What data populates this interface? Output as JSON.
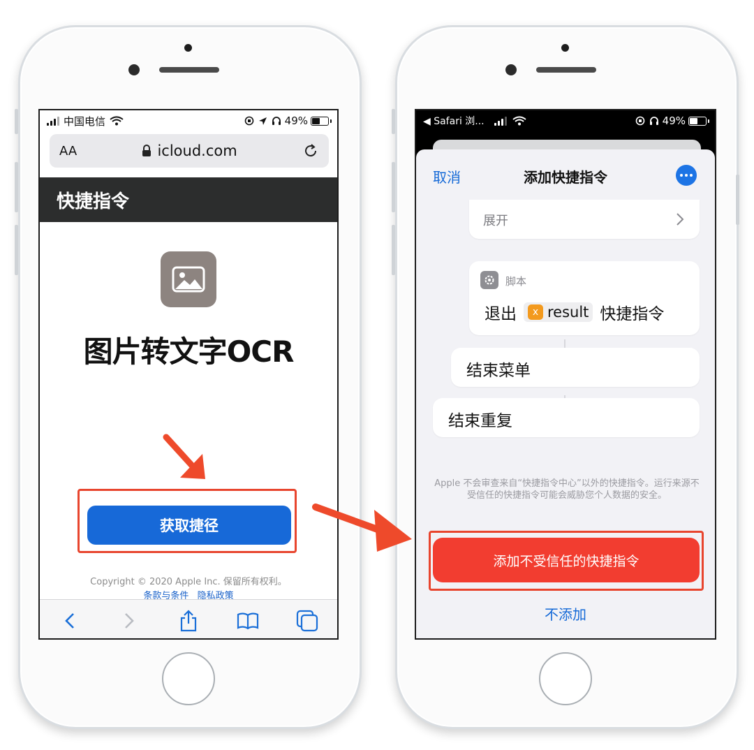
{
  "left_phone": {
    "status": {
      "carrier": "中国电信",
      "battery": "49%"
    },
    "url_bar": {
      "text_size": "AA",
      "url": "icloud.com"
    },
    "page_title": "快捷指令",
    "shortcut_name": "图片转文字OCR",
    "get_shortcut_label": "获取捷径",
    "copyright": "Copyright © 2020 Apple Inc. 保留所有权利。",
    "legal_links": [
      "条款与条件",
      "隐私政策"
    ],
    "toolbar_icons": [
      "back-icon",
      "forward-icon",
      "share-icon",
      "bookmarks-icon",
      "tabs-icon"
    ]
  },
  "right_phone": {
    "status": {
      "back_app": "◀ Safari 浏...",
      "battery": "49%"
    },
    "sheet": {
      "cancel_label": "取消",
      "title": "添加快捷指令",
      "more_icon": "more-icon"
    },
    "expand_card": {
      "label": "展开"
    },
    "script_card": {
      "category": "脚本",
      "action_prefix": "退出",
      "variable": "result",
      "action_suffix": "快捷指令"
    },
    "end_menu_label": "结束菜单",
    "end_repeat_label": "结束重复",
    "disclaimer": "Apple 不会审查来自“快捷指令中心”以外的快捷指令。运行来源不受信任的快捷指令可能会威胁您个人数据的安全。",
    "add_untrusted_label": "添加不受信任的快捷指令",
    "dont_add_label": "不添加"
  },
  "colors": {
    "accent_blue": "#1769d8",
    "danger_red": "#f23d30",
    "annotation_red": "#e8452e",
    "title_bar": "#2c2d2d"
  }
}
